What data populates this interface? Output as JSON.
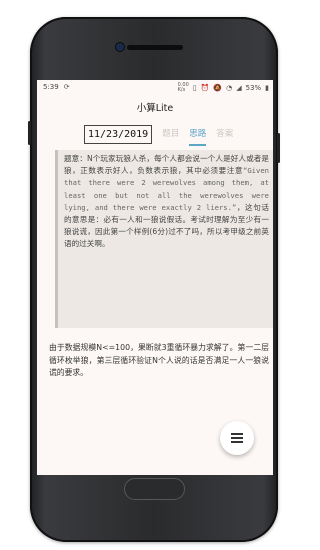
{
  "status_bar": {
    "time": "5:39",
    "left_icon": "sync-icon",
    "speed": "0.00\nK/s",
    "battery": "53%",
    "icons": [
      "network-speed",
      "sim-icon",
      "alarm-icon",
      "silent-icon",
      "wifi-icon",
      "signal-icon",
      "battery-icon"
    ]
  },
  "app": {
    "title": "小算Lite"
  },
  "tabs": {
    "date": "11/23/2019",
    "items": [
      "题目",
      "思路",
      "答案"
    ],
    "active_index": 1
  },
  "problem": {
    "prefix": "题意：",
    "p1": "N个玩家玩狼人杀，每个人都会说一个人是好人或者是狼，正数表示好人，负数表示狼，其中必须要注意",
    "quote_en": "“Given that there were 2 werewolves among them, at least one but not all the werewolves were lying, and there were exactly 2 liers.”",
    "p2": "，这句话的意思是：必有一人和一狼说假话。考试时理解为至少有一狼说谎，因此第一个样例(6分)过不了吗，所以考甲级之前英语的过关啊。"
  },
  "solution": {
    "text": "由于数据规模N<=100，果断就3重循环暴力求解了。第一二层循环枚举狼，第三层循环验证N个人说的话是否满足一人一狼说谎的要求。"
  },
  "fab": {
    "icon": "menu-icon"
  }
}
